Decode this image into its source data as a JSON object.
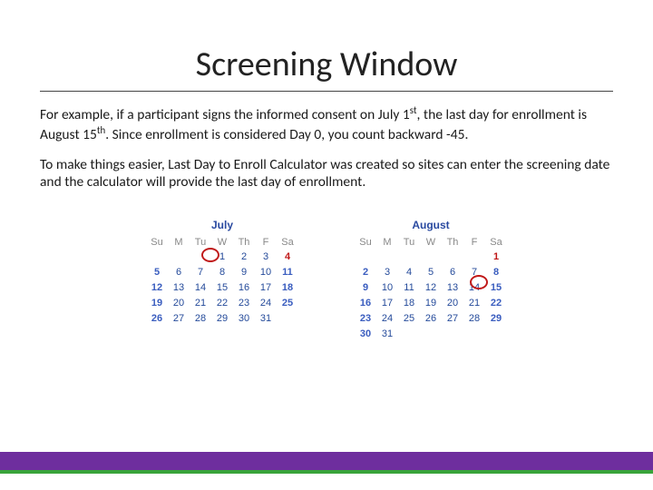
{
  "title": "Screening Window",
  "paragraphs": {
    "p1_a": "For example, if a participant signs the informed consent on July 1",
    "p1_sup1": "st",
    "p1_b": ", the last day for enrollment is August 15",
    "p1_sup2": "th",
    "p1_c": ".   Since enrollment is considered Day 0, you count backward -45.",
    "p2": "To make things easier, Last Day to Enroll Calculator was created so sites can enter the screening date and the calculator will provide the last day of enrollment."
  },
  "calendars": [
    {
      "name": "July",
      "dow": [
        "Su",
        "M",
        "Tu",
        "W",
        "Th",
        "F",
        "Sa"
      ],
      "weeks": [
        [
          "",
          "",
          "",
          "1",
          "2",
          "3",
          "4"
        ],
        [
          "5",
          "6",
          "7",
          "8",
          "9",
          "10",
          "11"
        ],
        [
          "12",
          "13",
          "14",
          "15",
          "16",
          "17",
          "18"
        ],
        [
          "19",
          "20",
          "21",
          "22",
          "23",
          "24",
          "25"
        ],
        [
          "26",
          "27",
          "28",
          "29",
          "30",
          "31",
          ""
        ]
      ],
      "holiday_col": 6,
      "holiday_row": 0,
      "circle": {
        "row": 0,
        "col": 3
      }
    },
    {
      "name": "August",
      "dow": [
        "Su",
        "M",
        "Tu",
        "W",
        "Th",
        "F",
        "Sa"
      ],
      "weeks": [
        [
          "",
          "",
          "",
          "",
          "",
          "",
          "1"
        ],
        [
          "2",
          "3",
          "4",
          "5",
          "6",
          "7",
          "8"
        ],
        [
          "9",
          "10",
          "11",
          "12",
          "13",
          "14",
          "15"
        ],
        [
          "16",
          "17",
          "18",
          "19",
          "20",
          "21",
          "22"
        ],
        [
          "23",
          "24",
          "25",
          "26",
          "27",
          "28",
          "29"
        ],
        [
          "30",
          "31",
          "",
          "",
          "",
          "",
          ""
        ]
      ],
      "holiday_col": 6,
      "holiday_row": 0,
      "circle": {
        "row": 2,
        "col": 6
      }
    }
  ]
}
